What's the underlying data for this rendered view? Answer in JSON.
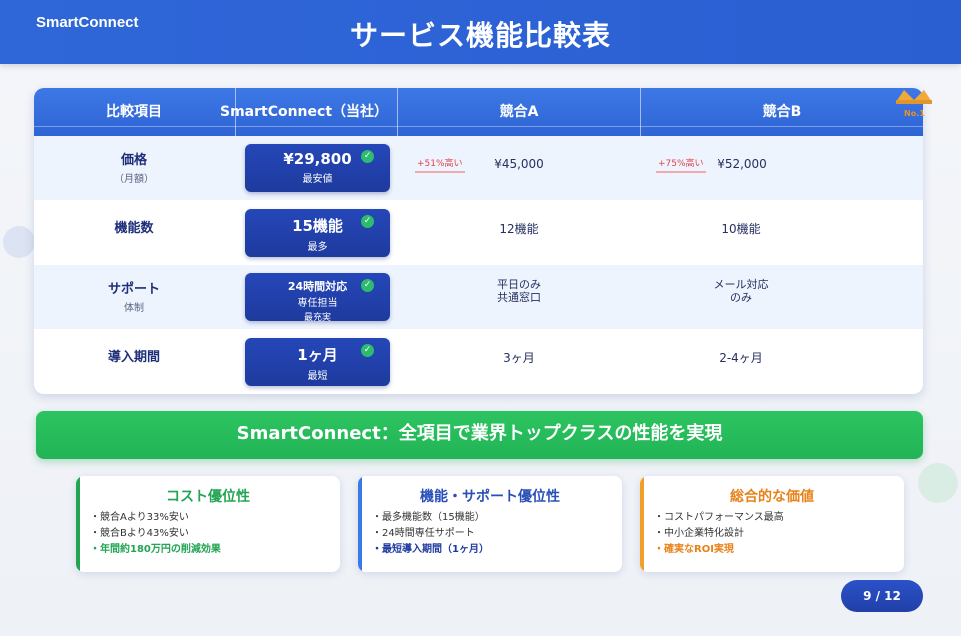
{
  "header": {
    "brand": "SmartConnect",
    "title": "サービス機能比較表"
  },
  "award": {
    "label": "No.1",
    "icon": "crown-icon",
    "color": "#f0a93a"
  },
  "table": {
    "headers": [
      "比較項目",
      "SmartConnect（当社）",
      "競合A",
      "競合B"
    ],
    "rows": [
      {
        "label": "価格",
        "sublabel": "（月額）",
        "ours": {
          "main": "¥29,800",
          "sub": "最安値",
          "tiny": ""
        },
        "a": {
          "value": "¥45,000",
          "badge": "+51%高い"
        },
        "b": {
          "value": "¥52,000",
          "badge": "+75%高い"
        }
      },
      {
        "label": "機能数",
        "sublabel": "",
        "ours": {
          "main": "15機能",
          "sub": "最多",
          "tiny": ""
        },
        "a": {
          "value": "12機能",
          "badge": ""
        },
        "b": {
          "value": "10機能",
          "badge": ""
        }
      },
      {
        "label": "サポート",
        "sublabel": "体制",
        "ours": {
          "main": "24時間対応",
          "sub": "専任担当",
          "tiny": "最充実"
        },
        "a": {
          "value": "平日のみ",
          "value2": "共通窓口",
          "badge": ""
        },
        "b": {
          "value": "メール対応",
          "value2": "のみ",
          "badge": ""
        }
      },
      {
        "label": "導入期間",
        "sublabel": "",
        "ours": {
          "main": "1ヶ月",
          "sub": "最短",
          "tiny": ""
        },
        "a": {
          "value": "3ヶ月",
          "badge": ""
        },
        "b": {
          "value": "2-4ヶ月",
          "badge": ""
        }
      }
    ]
  },
  "banner": {
    "text": "SmartConnect：全項目で業界トップクラスの性能を実現"
  },
  "cards": [
    {
      "title": "コスト優位性",
      "color": "#22a452",
      "items": [
        "・競合Aより33%安い",
        "・競合Bより43%安い"
      ],
      "highlight": "・年間約180万円の削減効果"
    },
    {
      "title": "機能・サポート優位性",
      "color": "#2a4fb8",
      "items": [
        "・最多機能数（15機能）",
        "・24時間専任サポート"
      ],
      "highlight": "・最短導入期間（1ヶ月）"
    },
    {
      "title": "総合的な価値",
      "color": "#e8821a",
      "items": [
        "・コストパフォーマンス最高",
        "・中小企業特化設計"
      ],
      "highlight": "・確実なROI実現"
    }
  ],
  "pagination": {
    "label": "9 / 12"
  }
}
